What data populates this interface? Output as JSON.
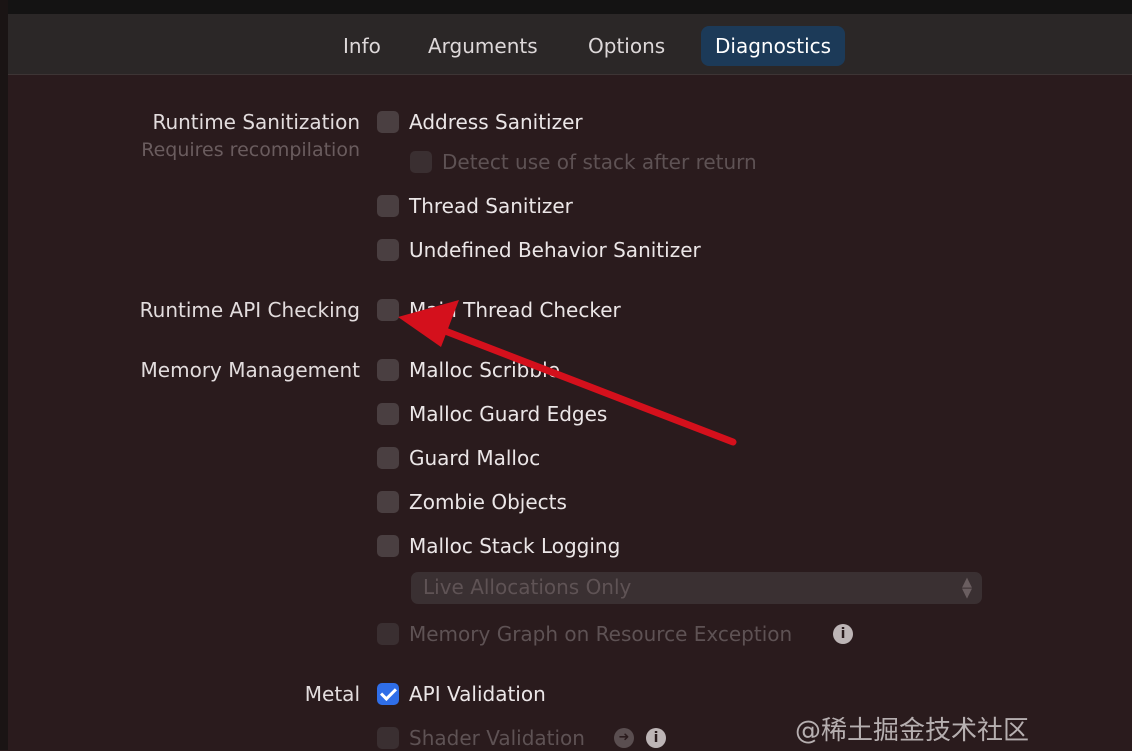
{
  "tabs": [
    {
      "label": "Info"
    },
    {
      "label": "Arguments"
    },
    {
      "label": "Options"
    },
    {
      "label": "Diagnostics",
      "active": true
    }
  ],
  "sections": {
    "runtime_sanitization": {
      "label": "Runtime Sanitization",
      "sublabel": "Requires recompilation",
      "address_sanitizer": "Address Sanitizer",
      "detect_stack": "Detect use of stack after return",
      "thread_sanitizer": "Thread Sanitizer",
      "ub_sanitizer": "Undefined Behavior Sanitizer"
    },
    "runtime_api": {
      "label": "Runtime API Checking",
      "main_thread_checker": "Main Thread Checker"
    },
    "memory": {
      "label": "Memory Management",
      "malloc_scribble": "Malloc Scribble",
      "malloc_guard_edges": "Malloc Guard Edges",
      "guard_malloc": "Guard Malloc",
      "zombie_objects": "Zombie Objects",
      "malloc_stack_logging": "Malloc Stack Logging",
      "allocations_select": "Live Allocations Only",
      "memory_graph": "Memory Graph on Resource Exception"
    },
    "metal": {
      "label": "Metal",
      "api_validation": "API Validation",
      "api_validation_checked": true,
      "shader_validation": "Shader Validation"
    }
  },
  "icons": {
    "info": "i",
    "go": "➜"
  },
  "watermark": "@稀土掘金技术社区",
  "colors": {
    "accent": "#2f6ee8",
    "active_tab": "#1c3a58",
    "annotation_arrow": "#d4101c"
  }
}
